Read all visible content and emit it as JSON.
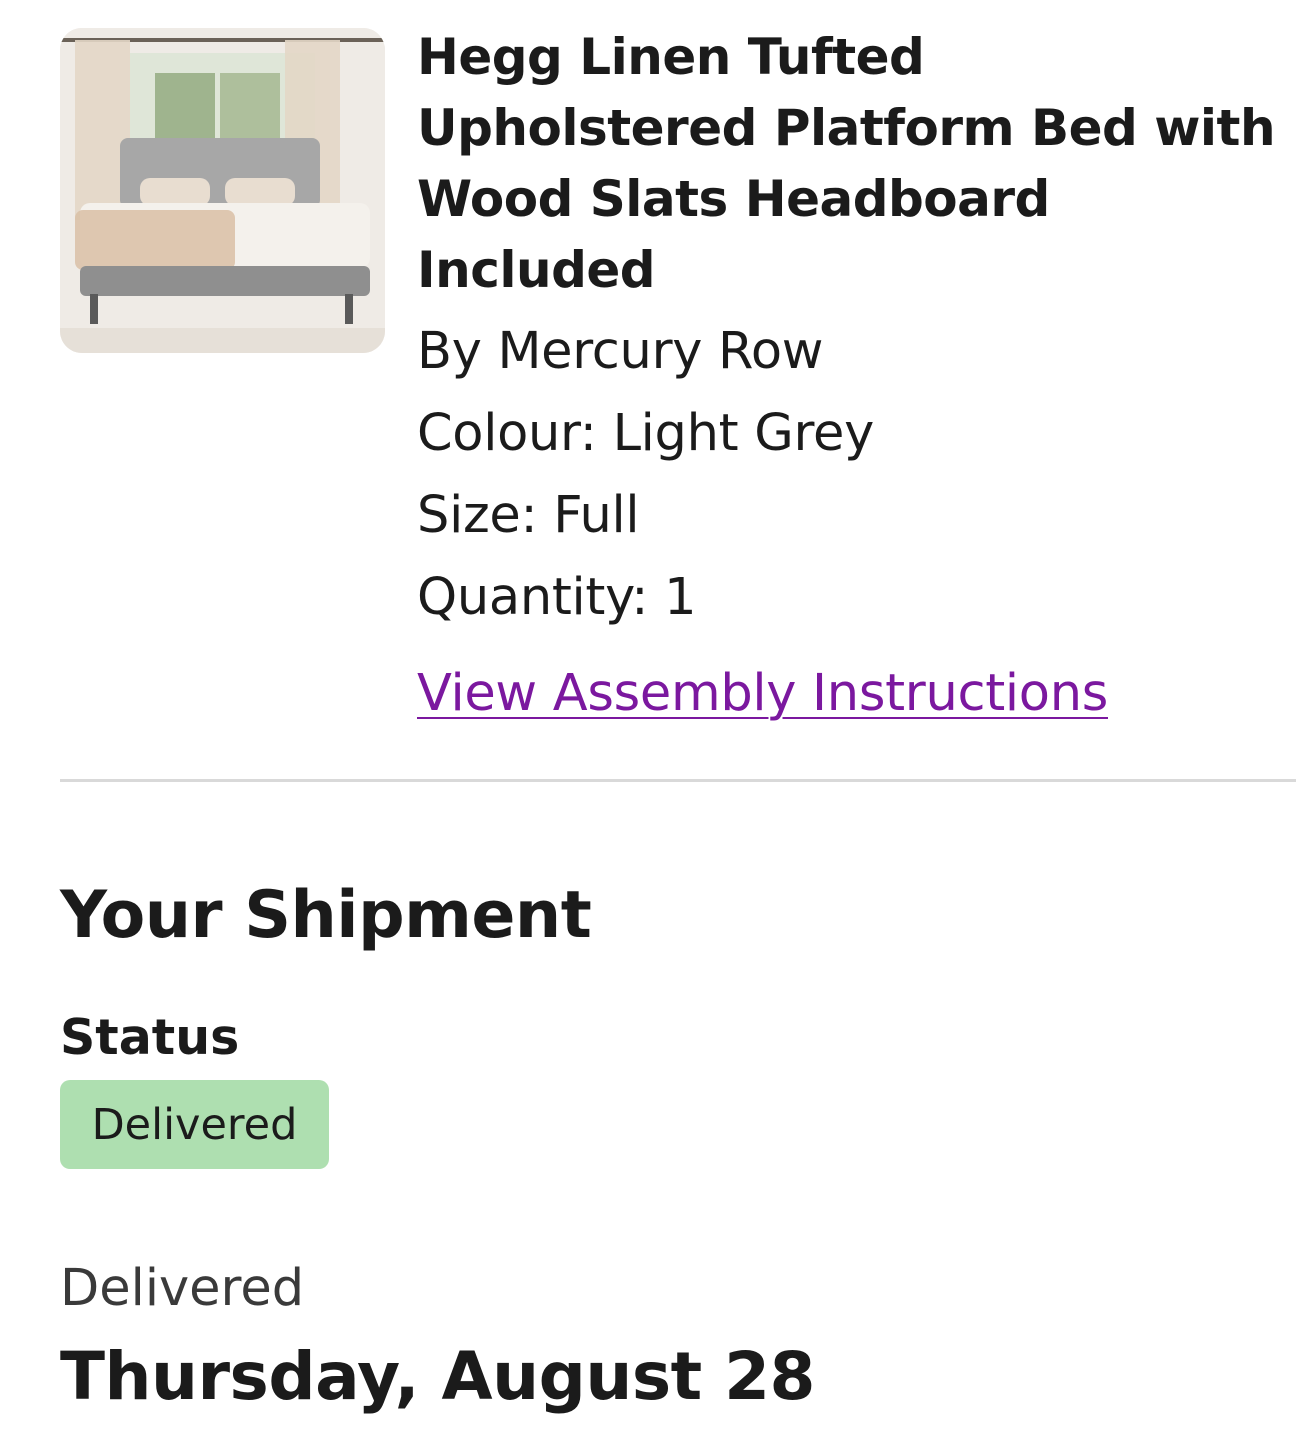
{
  "product": {
    "image": "bed-photo",
    "title": "Hegg Linen Tufted Upholstered Platform Bed with Wood Slats Headboard Included",
    "brand": "By Mercury Row",
    "colour": "Colour: Light Grey",
    "size": "Size: Full",
    "quantity": "Quantity: 1",
    "assembly_link": "View Assembly Instructions"
  },
  "shipment": {
    "heading": "Your Shipment",
    "status_label": "Status",
    "status_badge": "Delivered",
    "delivered_caption": "Delivered",
    "delivery_date": "Thursday, August 28"
  },
  "colors": {
    "link": "#7b189f",
    "badge_bg": "#aedfb0",
    "divider": "#d9d9d9"
  }
}
